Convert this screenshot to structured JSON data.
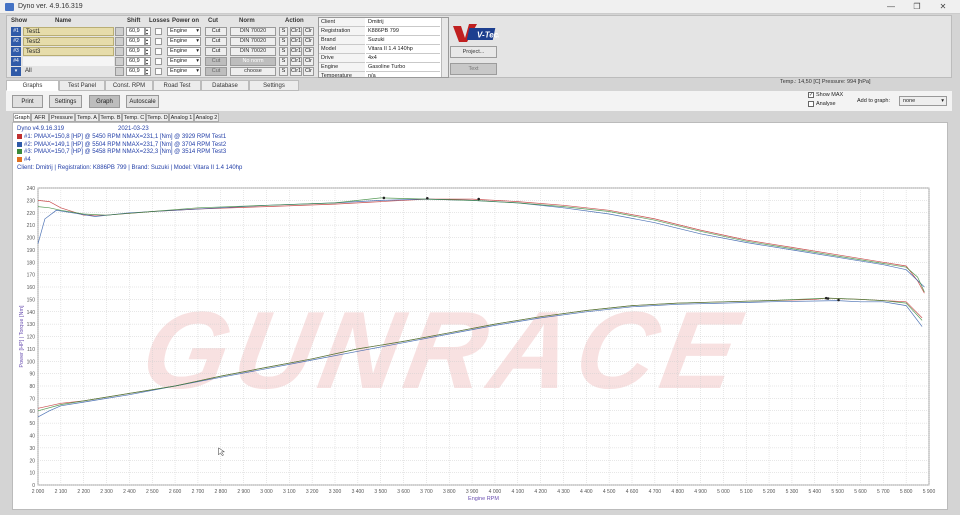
{
  "window": {
    "title": "Dyno ver. 4.9.16.319",
    "minimize": "—",
    "maximize": "❐",
    "close": "✕"
  },
  "runs_table": {
    "headers": {
      "show": "Show",
      "name": "Name",
      "shift": "Shift",
      "losses": "Losses",
      "power_on": "Power on",
      "cut": "Cut",
      "norm": "Norm",
      "action": "Action"
    },
    "rows": [
      {
        "slot": "#1",
        "name": "Test1",
        "shift": "60,9",
        "power_on": "Engine",
        "cut": "Cut",
        "norm": "DIN 70020",
        "a1": "S",
        "a2": "Clr1",
        "a3": "Clr"
      },
      {
        "slot": "#2",
        "name": "Test2",
        "shift": "60,9",
        "power_on": "Engine",
        "cut": "Cut",
        "norm": "DIN 70020",
        "a1": "S",
        "a2": "Clr1",
        "a3": "Clr"
      },
      {
        "slot": "#3",
        "name": "Test3",
        "shift": "60,9",
        "power_on": "Engine",
        "cut": "Cut",
        "norm": "DIN 70020",
        "a1": "S",
        "a2": "Clr1",
        "a3": "Clr"
      },
      {
        "slot": "#4",
        "name": "",
        "shift": "60,9",
        "power_on": "Engine",
        "cut": "Cut",
        "norm": "No norm",
        "a1": "S",
        "a2": "Clr1",
        "a3": "Clr"
      },
      {
        "slot": "▾",
        "name": "All",
        "shift": "60,9",
        "power_on": "Engine",
        "cut": "Cut",
        "norm": "choose",
        "a1": "S",
        "a2": "Clr1",
        "a3": "Clr"
      }
    ]
  },
  "vehicle_info": [
    {
      "key": "Client",
      "value": "Dmitrij"
    },
    {
      "key": "Registration",
      "value": "K886PB 799"
    },
    {
      "key": "Brand",
      "value": "Suzuki"
    },
    {
      "key": "Model",
      "value": "Vitara II 1.4 140hp"
    },
    {
      "key": "Drive",
      "value": "4x4"
    },
    {
      "key": "Engine",
      "value": "Gasoline Turbo"
    },
    {
      "key": "Temperature",
      "value": "n/a"
    }
  ],
  "logo": {
    "text": "V-Tech"
  },
  "project_button": "Project...",
  "text_button": "Text",
  "conditions": "Temp.: 14,50 [C]  Pressure: 994 [hPa]",
  "main_tabs": [
    "Graphs",
    "Test Panel",
    "Const. RPM",
    "Road Test",
    "Database",
    "Settings"
  ],
  "toolbar": {
    "print": "Print",
    "settings": "Settings",
    "graph": "Graph",
    "autoscale": "Autoscale"
  },
  "show_max": "Show MAX",
  "analyse": "Analyse",
  "add_to_graph_label": "Add to graph:",
  "add_to_graph_value": "none",
  "sub_tabs": [
    "Graph",
    "AFR",
    "Pressure",
    "Temp. A",
    "Temp. B",
    "Temp. C",
    "Temp. D",
    "Analog 1",
    "Analog 2"
  ],
  "graph_header": {
    "version": "Dyno v4.9.16.319",
    "date": "2021-03-23",
    "client_line": "Client: Dmitrij | Registration: K886PB 799 | Brand: Suzuki | Model: Vitara II 1.4 140hp"
  },
  "legend": [
    {
      "text": "#1: PMAX=150,8 [HP] @ 5450 RPM     NMAX=231,1 [Nm] @ 3929 RPM   Test1",
      "color": "#c03030"
    },
    {
      "text": "#2: PMAX=149,1 [HP] @ 5504 RPM     NMAX=231,7 [Nm] @ 3704 RPM   Test2",
      "color": "#2f5aa8"
    },
    {
      "text": "#3: PMAX=150,7 [HP] @ 5458 RPM     NMAX=232,3 [Nm] @ 3514 RPM   Test3",
      "color": "#3a8a3a"
    },
    {
      "text": "#4",
      "color": "#e07020"
    }
  ],
  "watermark": "GUNRACE",
  "chart_data": {
    "type": "line",
    "xlabel": "Engine RPM",
    "ylabel": "Power [HP] | Torque [Nm]",
    "xlim": [
      2000,
      5900
    ],
    "ylim": [
      0,
      240
    ],
    "x_ticks": [
      2000,
      2100,
      2200,
      2300,
      2400,
      2500,
      2600,
      2700,
      2800,
      2900,
      3000,
      3100,
      3200,
      3300,
      3400,
      3500,
      3600,
      3700,
      3800,
      3900,
      4000,
      4100,
      4200,
      4300,
      4400,
      4500,
      4600,
      4700,
      4800,
      4900,
      5000,
      5100,
      5200,
      5300,
      5400,
      5500,
      5600,
      5700,
      5800,
      5900
    ],
    "x_tick_labels": [
      "2 000",
      "2 100",
      "2 200",
      "2 300",
      "2 400",
      "2 500",
      "2 600",
      "2 700",
      "2 800",
      "2 900",
      "3 000",
      "3 100",
      "3 200",
      "3 300",
      "3 400",
      "3 500",
      "3 600",
      "3 700",
      "3 800",
      "3 900",
      "4 000",
      "4 100",
      "4 200",
      "4 300",
      "4 400",
      "4 500",
      "4 600",
      "4 700",
      "4 800",
      "4 900",
      "5 000",
      "5 100",
      "5 200",
      "5 300",
      "5 400",
      "5 500",
      "5 600",
      "5 700",
      "5 800",
      "5 900"
    ],
    "y_ticks": [
      0,
      10,
      20,
      30,
      40,
      50,
      60,
      70,
      80,
      90,
      100,
      110,
      120,
      130,
      140,
      150,
      160,
      170,
      180,
      190,
      200,
      210,
      220,
      230,
      240
    ],
    "grid": true,
    "series": [
      {
        "color": "#c03030",
        "kind": "torque",
        "x": [
          2000,
          2050,
          2100,
          2200,
          2300,
          2500,
          2700,
          3000,
          3300,
          3500,
          3700,
          3900,
          4100,
          4300,
          4500,
          4700,
          4900,
          5100,
          5300,
          5500,
          5700,
          5800,
          5850,
          5880
        ],
        "y": [
          230,
          229,
          224,
          218,
          218,
          221,
          223,
          225,
          227,
          229,
          231,
          231,
          229,
          226,
          222,
          215,
          206,
          198,
          192,
          186,
          180,
          177,
          165,
          155
        ]
      },
      {
        "color": "#2f5aa8",
        "kind": "torque",
        "x": [
          2000,
          2030,
          2080,
          2150,
          2250,
          2400,
          2600,
          2800,
          3000,
          3300,
          3500,
          3700,
          3900,
          4100,
          4300,
          4500,
          4700,
          4900,
          5100,
          5300,
          5500,
          5700,
          5800,
          5880
        ],
        "y": [
          195,
          215,
          222,
          220,
          217,
          220,
          222,
          224,
          226,
          228,
          230,
          231,
          230,
          228,
          224,
          219,
          212,
          203,
          196,
          190,
          184,
          178,
          174,
          160
        ]
      },
      {
        "color": "#3a8a3a",
        "kind": "torque",
        "x": [
          2000,
          2050,
          2100,
          2200,
          2300,
          2500,
          2700,
          3000,
          3300,
          3500,
          3700,
          3900,
          4100,
          4300,
          4500,
          4700,
          4900,
          5100,
          5300,
          5500,
          5700,
          5800,
          5850,
          5880
        ],
        "y": [
          225,
          224,
          222,
          219,
          218,
          221,
          224,
          226,
          228,
          232,
          231,
          230,
          228,
          225,
          221,
          214,
          205,
          197,
          191,
          185,
          179,
          176,
          168,
          156
        ]
      },
      {
        "color": "#c03030",
        "kind": "power",
        "x": [
          2000,
          2100,
          2200,
          2300,
          2400,
          2600,
          2800,
          3000,
          3200,
          3400,
          3600,
          3800,
          4000,
          4200,
          4400,
          4600,
          4800,
          5000,
          5200,
          5400,
          5450,
          5600,
          5700,
          5800,
          5870
        ],
        "y": [
          62,
          66,
          68,
          71,
          74,
          80,
          88,
          95,
          102,
          110,
          116,
          123,
          130,
          136,
          141,
          145,
          147,
          148,
          149,
          150,
          151,
          150,
          149,
          148,
          135
        ]
      },
      {
        "color": "#2f5aa8",
        "kind": "power",
        "x": [
          2000,
          2050,
          2100,
          2200,
          2300,
          2400,
          2600,
          2800,
          3000,
          3200,
          3400,
          3600,
          3800,
          4000,
          4200,
          4400,
          4600,
          4800,
          5000,
          5200,
          5500,
          5600,
          5700,
          5800,
          5870
        ],
        "y": [
          55,
          60,
          64,
          67,
          70,
          73,
          80,
          87,
          94,
          101,
          108,
          115,
          122,
          129,
          135,
          140,
          144,
          146,
          147,
          148,
          149,
          148,
          148,
          145,
          128
        ]
      },
      {
        "color": "#3a8a3a",
        "kind": "power",
        "x": [
          2000,
          2100,
          2200,
          2300,
          2400,
          2600,
          2800,
          3000,
          3200,
          3400,
          3600,
          3800,
          4000,
          4200,
          4400,
          4600,
          4800,
          5000,
          5200,
          5458,
          5600,
          5700,
          5800,
          5870
        ],
        "y": [
          60,
          65,
          68,
          71,
          74,
          80,
          88,
          95,
          102,
          110,
          116,
          123,
          130,
          136,
          141,
          145,
          147,
          148,
          149,
          151,
          150,
          149,
          147,
          133
        ]
      }
    ]
  }
}
